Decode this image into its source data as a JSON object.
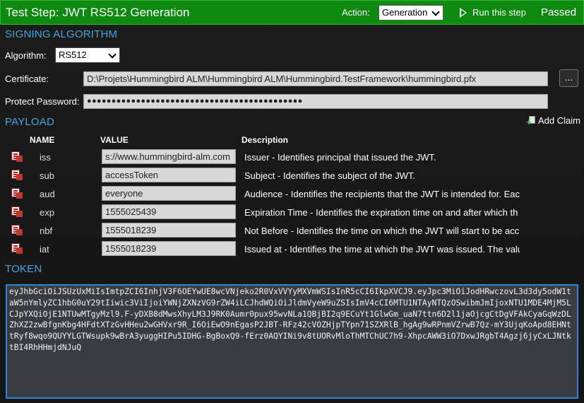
{
  "header": {
    "title": "Test Step: JWT RS512 Generation",
    "action_label": "Action:",
    "action_value": "Generation",
    "run_label": "Run this step",
    "status": "Passed"
  },
  "signing": {
    "section_title": "SIGNING ALGORITHM",
    "algorithm_label": "Algorithm:",
    "algorithm_value": "RS512",
    "certificate_label": "Certificate:",
    "certificate_value": "D:\\Projets\\Hummingbird ALM\\Hummingbird ALM\\Hummingbird.TestFramework\\hummingbird.pfx",
    "browse_label": "...",
    "password_label": "Protect Password:",
    "password_value": "●●●●●●●●●●●●●●●●●●●●●●●●●●●●●●●●●●●●●●●●●●●●"
  },
  "payload": {
    "section_title": "PAYLOAD",
    "add_claim_label": "Add Claim",
    "columns": {
      "name": "NAME",
      "value": "VALUE",
      "description": "Description"
    },
    "claims": [
      {
        "name": "iss",
        "value": "s://www.hummingbird-alm.com",
        "description": "Issuer - Identifies principal that issued the JWT."
      },
      {
        "name": "sub",
        "value": "accessToken",
        "description": "Subject - Identifies the subject of the JWT."
      },
      {
        "name": "aud",
        "value": "everyone",
        "description": "Audience - Identifies the recipients that the JWT is intended for. Eac"
      },
      {
        "name": "exp",
        "value": "1555025439",
        "description": "Expiration Time - Identifies the expiration time on and after which th"
      },
      {
        "name": "nbf",
        "value": "1555018239",
        "description": "Not Before - Identifies the time on which the JWT will start to be acc"
      },
      {
        "name": "iat",
        "value": "1555018239",
        "description": "Issued at - Identifies the time at which the JWT was issued. The valu"
      }
    ]
  },
  "token": {
    "section_title": "TOKEN",
    "value": "eyJhbGciOiJSUzUxMiIsImtpZCI6InhjV3F6OEYwUE8wcVNjeko2R0VxVVYyMXVmWSIsInR5cCI6IkpXVCJ9.eyJpc3MiOiJodHRwczovL3d3dy5odW1taW5nYmlyZC1hbG0uY29tIiwic3ViIjoiYWNjZXNzVG9rZW4iLCJhdWQiOiJldmVyeW9uZSIsImV4cCI6MTU1NTAyNTQzOSwibmJmIjoxNTU1MDE4MjM5LCJpYXQiOjE1NTUwMTgyMzl9.F-yDXB8dMwsXhyLM3J9RK0Aumr0pux95wvNLa1QBjBI2q9ECuYt1GlwGm_uaN7ttn6D2l1jaOjcgCtDgVFAkCyaGqWzDLZhXZ2zwBfgnKbg4HFdtXTzGvHHeu2wGHVxr9R_I6OiEwO9nEgasP2JBT-RFz42cVOZHjpTYpn71SZXRlB_hgAg9wRPnmVZrwB7Qz-mY3UjqKoApd8EHNttRyf8wqo9QUYYLGTWsupk9wBrA3yuggHIPu5IDHG-BgBoxQ9-fErz0AQYINi9v8tUORvMloThMTChUC7h9-XhpcAWW3iO7DxwJRgbT4Agzj6jyCxLJNtktBI4RhHHmjdNJuQ"
  }
}
